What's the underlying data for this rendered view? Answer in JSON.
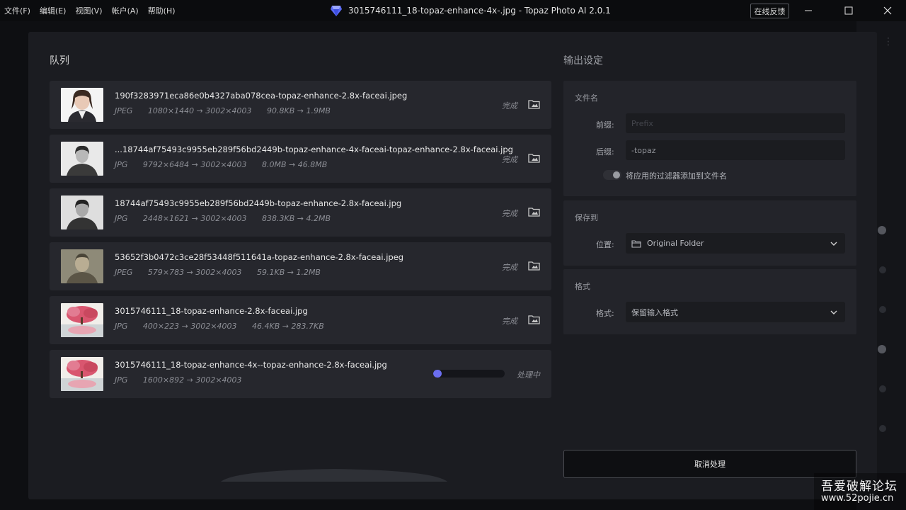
{
  "menu": [
    "文件(F)",
    "编辑(E)",
    "视图(V)",
    "帐户(A)",
    "帮助(H)"
  ],
  "window_title": "3015746111_18-topaz-enhance-4x-.jpg - Topaz Photo AI 2.0.1",
  "feedback_label": "在线反馈",
  "queue": {
    "title": "队列",
    "items": [
      {
        "name": "190f3283971eca86e0b4327aba078cea-topaz-enhance-2.8x-faceai.jpeg",
        "format": "JPEG",
        "dims": "1080×1440 → 3002×4003",
        "size": "90.8KB → 1.9MB",
        "status": "完成"
      },
      {
        "name": "...18744af75493c9955eb289f56bd2449b-topaz-enhance-4x-faceai-topaz-enhance-2.8x-faceai.jpg",
        "format": "JPG",
        "dims": "9792×6484 → 3002×4003",
        "size": "8.0MB → 46.8MB",
        "status": "完成"
      },
      {
        "name": "18744af75493c9955eb289f56bd2449b-topaz-enhance-2.8x-faceai.jpg",
        "format": "JPG",
        "dims": "2448×1621 → 3002×4003",
        "size": "838.3KB → 4.2MB",
        "status": "完成"
      },
      {
        "name": "53652f3b0472c3ce28f53448f511641a-topaz-enhance-2.8x-faceai.jpeg",
        "format": "JPEG",
        "dims": "579×783 → 3002×4003",
        "size": "59.1KB → 1.2MB",
        "status": "完成"
      },
      {
        "name": "3015746111_18-topaz-enhance-2.8x-faceai.jpg",
        "format": "JPG",
        "dims": "400×223 → 3002×4003",
        "size": "46.4KB → 283.7KB",
        "status": "完成"
      },
      {
        "name": "3015746111_18-topaz-enhance-4x--topaz-enhance-2.8x-faceai.jpg",
        "format": "JPG",
        "dims": "1600×892 → 3002×4003",
        "status": "处理中",
        "progress": 0.12
      }
    ]
  },
  "output": {
    "title": "输出设定",
    "filename_section": "文件名",
    "prefix_label": "前缀:",
    "prefix_placeholder": "Prefix",
    "suffix_label": "后缀:",
    "suffix_value": "-topaz",
    "filter_toggle_label": "将应用的过滤器添加到文件名",
    "save_section": "保存到",
    "location_label": "位置:",
    "location_value": "Original Folder",
    "format_section": "格式",
    "format_label": "格式:",
    "format_value": "保留输入格式",
    "cancel_label": "取消处理"
  },
  "watermark": {
    "line1": "吾爱破解论坛",
    "line2": "www.52pojie.cn"
  }
}
